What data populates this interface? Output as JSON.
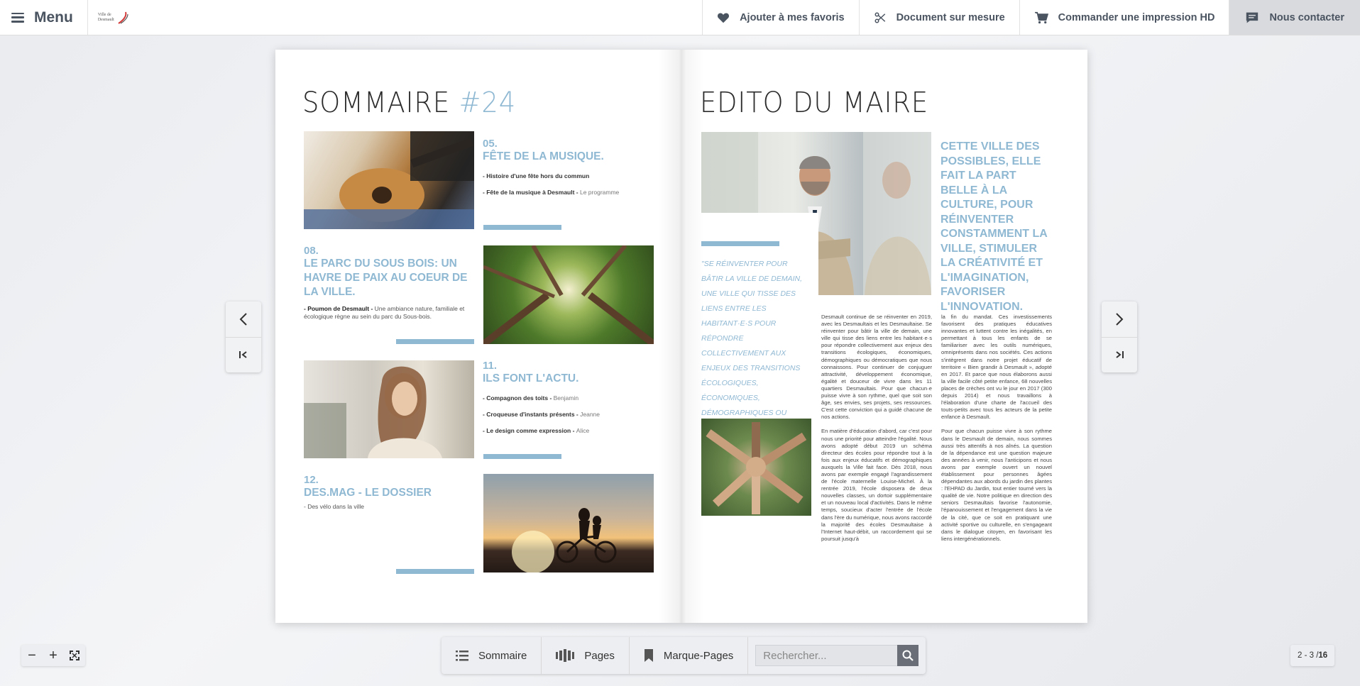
{
  "header": {
    "menu_label": "Menu",
    "logo_line1": "Ville de",
    "logo_line2": "Desmault",
    "actions": {
      "favorites": "Ajouter à mes favoris",
      "custom_doc": "Document sur mesure",
      "order_print": "Commander une impression HD",
      "contact": "Nous contacter"
    }
  },
  "left_page": {
    "title": "SOMMAIRE ",
    "title_num": "#24",
    "sections": [
      {
        "num": "05.",
        "title": "FÊTE DE LA MUSIQUE.",
        "items": [
          {
            "bold": "- Histoire d'une fête hors du commun",
            "light": ""
          },
          {
            "bold": "- Fête de la musique à Desmault - ",
            "light": "Le programme"
          }
        ]
      },
      {
        "num": "08.",
        "title": "LE PARC DU SOUS BOIS: UN HAVRE DE PAIX AU COEUR DE LA VILLE.",
        "desc_bold": "- Poumon de Desmault - ",
        "desc": "Une ambiance nature, familiale et écologique règne au sein du parc du Sous-bois."
      },
      {
        "num": "11.",
        "title": "ILS FONT L'ACTU.",
        "items": [
          {
            "bold": "- Compagnon des toits - ",
            "light": "Benjamin"
          },
          {
            "bold": "- Croqueuse d'instants présents - ",
            "light": "Jeanne"
          },
          {
            "bold": "- Le design comme expression - ",
            "light": "Alice"
          }
        ]
      },
      {
        "num": "12.",
        "title": "DES.MAG - LE DOSSIER",
        "desc_bold": "",
        "desc": "- Des vélo dans la ville"
      }
    ]
  },
  "right_page": {
    "title": "EDITO DU MAIRE",
    "quote_blue": "CETTE VILLE DES POSSIBLES, ELLE FAIT LA PART BELLE À LA CULTURE, POUR RÉINVENTER CONSTAMMENT LA VILLE, STIMULER LA CRÉATIVITÉ ET L'IMAGINATION, FAVORISER L'INNOVATION.",
    "quote_italic": "\"SE RÉINVENTER POUR BÂTIR LA VILLE DE DEMAIN, UNE VILLE QUI TISSE DES LIENS ENTRE LES HABITANT·E·S POUR RÉPONDRE COLLECTIVEMENT AUX ENJEUX DES TRANSITIONS ÉCOLOGIQUES, ÉCONOMIQUES, DÉMOGRAPHIQUES OU DÉMOCRATIQUES QUE NOUS CONNAISSONS.\"",
    "col1_p1": "Desmault continue de se réinventer en 2019, avec les Desmaultais et les Desmaultaise. Se réinventer pour bâtir la ville de demain, une ville qui tisse des liens entre les habitant·e·s pour répondre collectivement aux enjeux des transitions écologiques, économiques, démographiques ou démocratiques que nous connaissons. Pour continuer de conjuguer attractivité, développement économique, égalité et douceur de vivre dans les 11 quartiers Desmaultais. Pour que chacun·e puisse vivre à son rythme, quel que soit son âge, ses envies, ses projets, ses ressources. C'est cette conviction qui a guidé chacune de nos actions.",
    "col1_p2": "En matière d'éducation d'abord, car c'est pour nous une priorité pour atteindre l'égalité. Nous avons adopté début 2019 un schéma directeur des écoles pour répondre tout à la fois aux enjeux éducatifs et démographiques auxquels la Ville fait face. Dès 2018, nous avons par exemple engagé l'agrandissement de l'école maternelle Louise-Michel. À la rentrée 2019, l'école disposera de deux nouvelles classes, un dortoir supplémentaire et un nouveau local d'activités. Dans le même temps, soucieux d'acter l'entrée de l'école dans l'ère du numérique, nous avons raccordé la majorité des écoles Desmaultaise à l'Internet haut-débit, un raccordement qui se poursuit jusqu'à",
    "col2_p1": "la fin du mandat. Ces investissements favorisent des pratiques éducatives innovantes et luttent contre les inégalités, en permettant à tous les enfants de se familiariser avec les outils numériques, omniprésents dans nos sociétés. Ces actions s'intègrent dans notre projet éducatif de territoire « Bien grandir à Desmault », adopté en 2017. Et parce que nous élaborons aussi la ville facile côté petite enfance, 68 nouvelles places de crèches ont vu le jour en 2017 (300 depuis 2014) et nous travaillons à l'élaboration d'une charte de l'accueil des touts-petits avec tous les acteurs de la petite enfance à Desmault.",
    "col2_p2": "Pour que chacun puisse vivre à son rythme dans le Desmault de demain, nous sommes aussi très attentifs à nos aînés. La question de la dépendance est une question majeure des années à venir, nous l'anticipons et nous avons par exemple ouvert un nouvel établissement pour personnes âgées dépendantes aux abords du jardin des plantes : l'EHPAD du Jardin, tout entier tourné vers la qualité de vie. Notre politique en direction des seniors Desmaultais favorise l'autonomie, l'épanouissement et l'engagement dans la vie de la cité, que ce soit en pratiquant une activité sportive ou culturelle, en s'engageant dans le dialogue citoyen, en favorisant les liens intergénérationnels."
  },
  "toolbar": {
    "sommaire": "Sommaire",
    "pages": "Pages",
    "bookmarks": "Marque-Pages",
    "search_placeholder": "Rechercher..."
  },
  "zoom": {
    "minus": "−",
    "plus": "+"
  },
  "pagination": {
    "current": "2 - 3 / ",
    "total": "16"
  },
  "colors": {
    "accent": "#8fb8d3",
    "text_dark": "#4a5360"
  }
}
